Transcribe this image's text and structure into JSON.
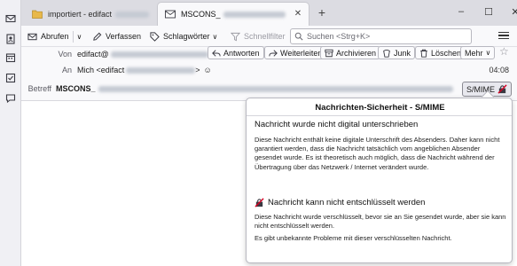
{
  "tabs": [
    {
      "label": "importiert - edifact",
      "active": false
    },
    {
      "label": "MSCONS_",
      "active": true
    }
  ],
  "window_controls": {
    "minimize": "–",
    "maximize": "☐",
    "close": "✕"
  },
  "toolbar": {
    "get_messages": "Abrufen",
    "write": "Verfassen",
    "tags": "Schlagwörter",
    "quick_filter": "Schnellfilter",
    "search_placeholder": "Suchen <Strg+K>"
  },
  "header": {
    "from_label": "Von",
    "from_value": "edifact@",
    "to_label": "An",
    "to_value": "Mich <edifact",
    "to_suffix": ">",
    "subject_label": "Betreff",
    "subject_value": "MSCONS_",
    "time": "04:08",
    "smime_label": "S/MIME"
  },
  "actions": {
    "reply": "Antworten",
    "forward": "Weiterleiten",
    "archive": "Archivieren",
    "junk": "Junk",
    "delete": "Löschen",
    "more": "Mehr"
  },
  "security_popup": {
    "title": "Nachrichten-Sicherheit - S/MIME",
    "sig_heading": "Nachricht wurde nicht digital unterschrieben",
    "sig_text": "Diese Nachricht enthält keine digitale Unterschrift des Absenders. Daher kann nicht garantiert werden, dass die Nachricht tatsächlich vom angeblichen Absender gesendet wurde. Es ist theoretisch auch möglich, dass die Nachricht während der Übertragung über das Netzwerk / Internet verändert wurde.",
    "enc_heading": "Nachricht kann nicht entschlüsselt werden",
    "enc_text": "Diese Nachricht wurde verschlüsselt, bevor sie an Sie gesendet wurde, aber sie kann nicht entschlüsselt werden.",
    "enc_text2": "Es gibt unbekannte Probleme mit dieser verschlüsselten Nachricht."
  },
  "colors": {
    "accent": "#0060df",
    "error": "#d70022",
    "toolbar_bg": "#f9f9fb",
    "tab_strip": "#dcdce2"
  }
}
